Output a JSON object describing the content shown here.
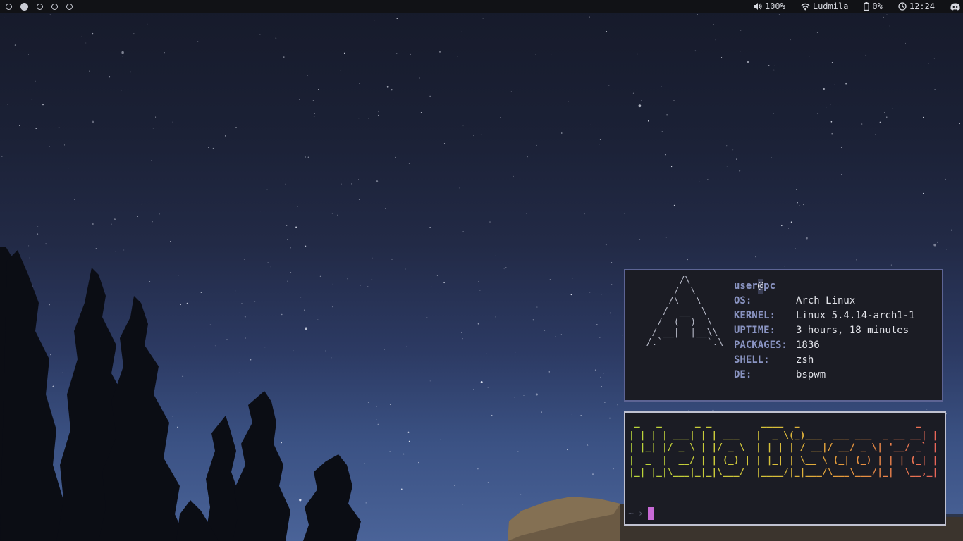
{
  "topbar": {
    "workspaces": [
      {
        "active": false
      },
      {
        "active": true
      },
      {
        "active": false
      },
      {
        "active": false
      },
      {
        "active": false
      }
    ],
    "volume": {
      "icon": "speaker-icon",
      "value": "100%"
    },
    "wifi": {
      "icon": "wifi-icon",
      "ssid": "Ludmila"
    },
    "battery": {
      "icon": "battery-icon",
      "value": "0%"
    },
    "clock": {
      "icon": "clock-icon",
      "time": "12:24"
    },
    "tray": {
      "icon": "discord-icon"
    }
  },
  "neofetch": {
    "user": "user",
    "at": "@",
    "host": "pc",
    "rows": [
      {
        "key": "OS:",
        "value": "Arch Linux"
      },
      {
        "key": "KERNEL:",
        "value": "Linux 5.4.14-arch1-1"
      },
      {
        "key": "UPTIME:",
        "value": "3 hours, 18 minutes"
      },
      {
        "key": "PACKAGES:",
        "value": "1836"
      },
      {
        "key": "SHELL:",
        "value": "zsh"
      },
      {
        "key": "DE:",
        "value": "bspwm"
      }
    ],
    "ascii_logo": "        /\\\n       /  \\\n      /\\   \\\n     /  __  \\\n    /  (  )  \\\n   / __|  |__\\\\\n  /.`        `.\\"
  },
  "terminal2": {
    "banner": " _   _      _ _         ____  _                     _ \n| | | | ___| | | ___   |  _ \\(_)___  ___ ___  _ __ __| |\n| |_| |/ _ \\ | |/ _ \\  | | | | / __|/ __/ _ \\| '__/ _` |\n|  _  |  __/ | | (_) | | |_| | \\__ \\ (_| (_) | | | (_| |\n|_| |_|\\___|_|_|\\___/  |____/|_|___/\\___\\___/|_|  \\__,_|",
    "prompt_path": "~",
    "prompt_symbol": "›"
  },
  "colors": {
    "topbar_bg": "#111216",
    "term_bg": "#1b1c24",
    "term1_border": "#5d6494",
    "term2_border": "#bfc1d0",
    "key_color": "#8a94c2",
    "cursor": "#c86ad6"
  }
}
